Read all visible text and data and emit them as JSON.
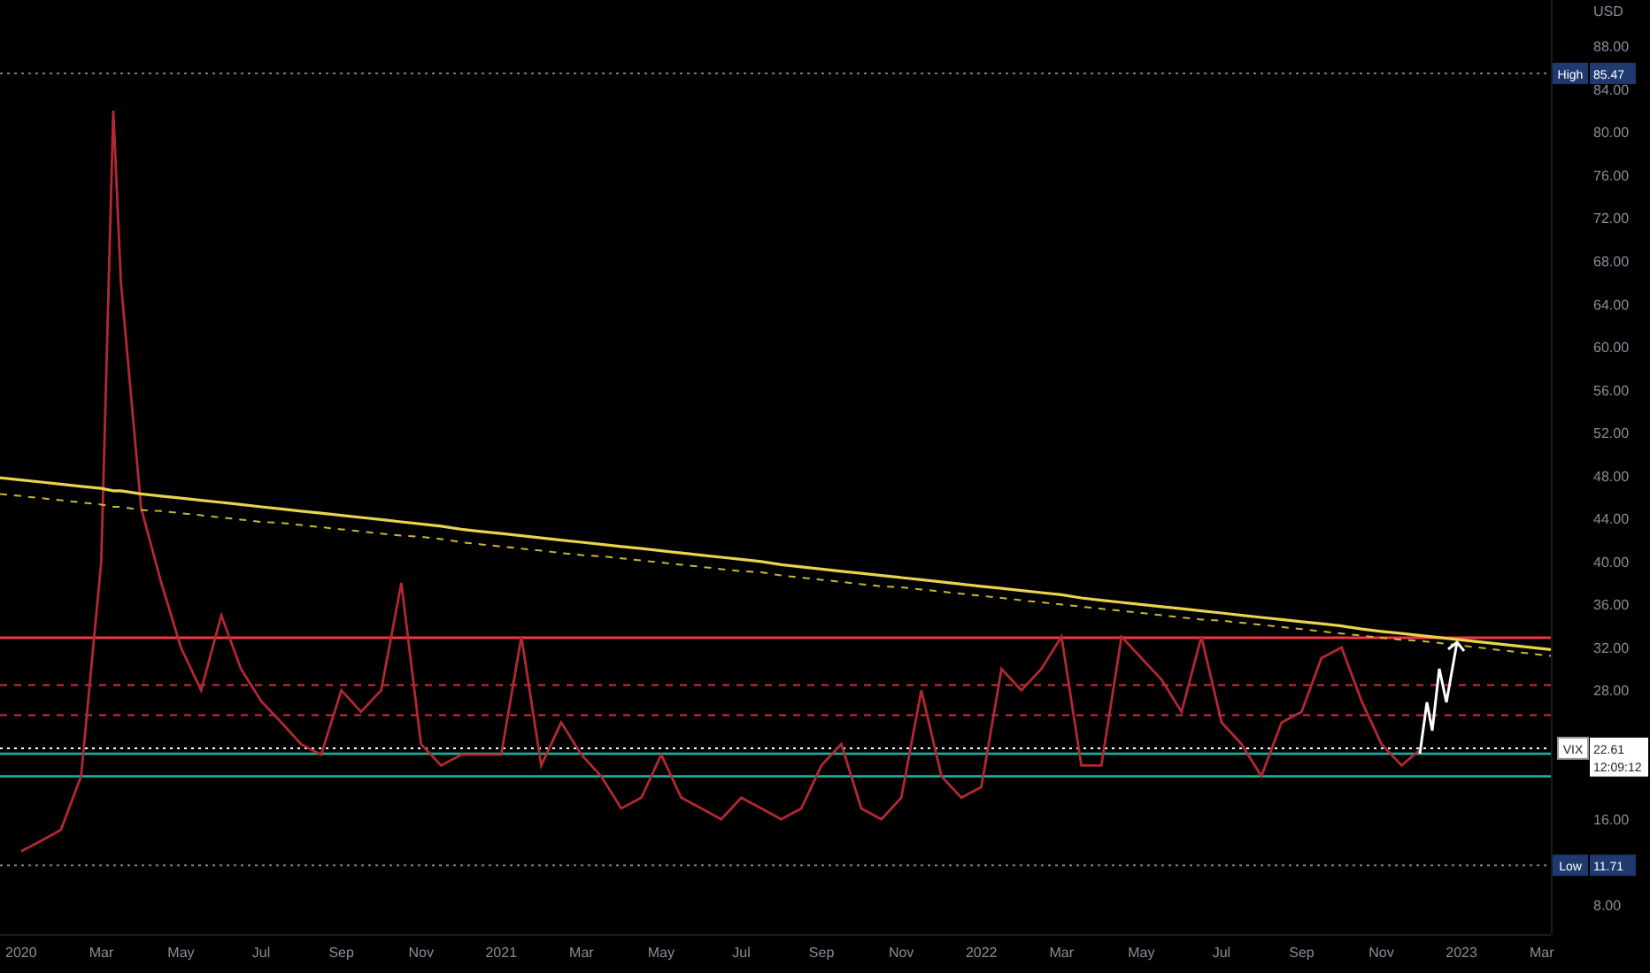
{
  "chart_data": {
    "type": "line",
    "ylabel": "USD",
    "xlim": [
      2019.956,
      2023.186
    ],
    "ylim": [
      5.3,
      92.3
    ],
    "xticks": [
      {
        "value": 2020,
        "label": "2020"
      },
      {
        "value": 2020.167,
        "label": "Mar"
      },
      {
        "value": 2020.333,
        "label": "May"
      },
      {
        "value": 2020.5,
        "label": "Jul"
      },
      {
        "value": 2020.667,
        "label": "Sep"
      },
      {
        "value": 2020.833,
        "label": "Nov"
      },
      {
        "value": 2021,
        "label": "2021"
      },
      {
        "value": 2021.167,
        "label": "Mar"
      },
      {
        "value": 2021.333,
        "label": "May"
      },
      {
        "value": 2021.5,
        "label": "Jul"
      },
      {
        "value": 2021.667,
        "label": "Sep"
      },
      {
        "value": 2021.833,
        "label": "Nov"
      },
      {
        "value": 2022,
        "label": "2022"
      },
      {
        "value": 2022.167,
        "label": "Mar"
      },
      {
        "value": 2022.333,
        "label": "May"
      },
      {
        "value": 2022.5,
        "label": "Jul"
      },
      {
        "value": 2022.667,
        "label": "Sep"
      },
      {
        "value": 2022.833,
        "label": "Nov"
      },
      {
        "value": 2023,
        "label": "2023"
      },
      {
        "value": 2023.167,
        "label": "Mar"
      }
    ],
    "yticks": [
      {
        "value": 88,
        "label": "88.00"
      },
      {
        "value": 84,
        "label": "84.00"
      },
      {
        "value": 80,
        "label": "80.00"
      },
      {
        "value": 76,
        "label": "76.00"
      },
      {
        "value": 72,
        "label": "72.00"
      },
      {
        "value": 68,
        "label": "68.00"
      },
      {
        "value": 64,
        "label": "64.00"
      },
      {
        "value": 60,
        "label": "60.00"
      },
      {
        "value": 56,
        "label": "56.00"
      },
      {
        "value": 52,
        "label": "52.00"
      },
      {
        "value": 48,
        "label": "48.00"
      },
      {
        "value": 44,
        "label": "44.00"
      },
      {
        "value": 40,
        "label": "40.00"
      },
      {
        "value": 36,
        "label": "36.00"
      },
      {
        "value": 32,
        "label": "32.00"
      },
      {
        "value": 28,
        "label": "28.00"
      },
      {
        "value": 16,
        "label": "16.00"
      },
      {
        "value": 8,
        "label": "8.00"
      }
    ],
    "x": [
      2019.956,
      2020,
      2020.042,
      2020.083,
      2020.125,
      2020.167,
      2020.192,
      2020.208,
      2020.25,
      2020.292,
      2020.333,
      2020.375,
      2020.417,
      2020.458,
      2020.5,
      2020.542,
      2020.583,
      2020.625,
      2020.667,
      2020.708,
      2020.75,
      2020.792,
      2020.833,
      2020.875,
      2020.917,
      2020.958,
      2021,
      2021.042,
      2021.083,
      2021.125,
      2021.167,
      2021.208,
      2021.25,
      2021.292,
      2021.333,
      2021.375,
      2021.417,
      2021.458,
      2021.5,
      2021.542,
      2021.583,
      2021.625,
      2021.667,
      2021.708,
      2021.75,
      2021.792,
      2021.833,
      2021.875,
      2021.917,
      2021.958,
      2022,
      2022.042,
      2022.083,
      2022.125,
      2022.167,
      2022.208,
      2022.25,
      2022.292,
      2022.333,
      2022.375,
      2022.417,
      2022.458,
      2022.5,
      2022.542,
      2022.583,
      2022.625,
      2022.667,
      2022.708,
      2022.75,
      2022.792,
      2022.833,
      2022.875,
      2022.917,
      2023.186
    ],
    "series": [
      {
        "name": "VIX",
        "color": "#b22833",
        "values": [
          null,
          13,
          14,
          15,
          20,
          40,
          82,
          66,
          45,
          38,
          32,
          28,
          35,
          30,
          27,
          25,
          23,
          22,
          28,
          26,
          28,
          38,
          23,
          21,
          22,
          22,
          22,
          33,
          21,
          25,
          22,
          20,
          17,
          18,
          22,
          18,
          17,
          16,
          18,
          17,
          16,
          17,
          21,
          23,
          17,
          16,
          18,
          28,
          20,
          18,
          19,
          30,
          28,
          30,
          33,
          21,
          21,
          33,
          31,
          29,
          26,
          33,
          25,
          23,
          20,
          25,
          26,
          31,
          32,
          27,
          23,
          21,
          22.6,
          null
        ]
      },
      {
        "color": "#e8d44d",
        "values": [
          47.8,
          47.6,
          47.4,
          47.2,
          47.0,
          46.8,
          46.6,
          46.6,
          46.3,
          46.1,
          45.9,
          45.7,
          45.5,
          45.3,
          45.1,
          44.9,
          44.7,
          44.5,
          44.3,
          44.1,
          43.9,
          43.7,
          43.5,
          43.3,
          43.0,
          42.8,
          42.6,
          42.4,
          42.2,
          42.0,
          41.8,
          41.6,
          41.4,
          41.2,
          41.0,
          40.8,
          40.6,
          40.4,
          40.2,
          40.0,
          39.7,
          39.5,
          39.3,
          39.1,
          38.9,
          38.7,
          38.5,
          38.3,
          38.1,
          37.9,
          37.7,
          37.5,
          37.3,
          37.1,
          36.9,
          36.6,
          36.4,
          36.2,
          36.0,
          35.8,
          35.6,
          35.4,
          35.2,
          35.0,
          34.8,
          34.6,
          34.4,
          34.2,
          34.0,
          33.7,
          33.5,
          33.3,
          33.1,
          31.8
        ]
      },
      {
        "color": "#c9b53a",
        "line_style": "dashed",
        "values": [
          46.3,
          46.1,
          45.9,
          45.7,
          45.5,
          45.3,
          45.1,
          45.1,
          44.8,
          44.7,
          44.5,
          44.3,
          44.1,
          43.9,
          43.7,
          43.6,
          43.4,
          43.2,
          43.0,
          42.8,
          42.6,
          42.4,
          42.3,
          42.1,
          41.8,
          41.6,
          41.4,
          41.2,
          41.0,
          40.8,
          40.6,
          40.5,
          40.3,
          40.1,
          39.9,
          39.7,
          39.5,
          39.3,
          39.1,
          39.0,
          38.7,
          38.5,
          38.3,
          38.1,
          37.9,
          37.7,
          37.6,
          37.4,
          37.2,
          37.0,
          36.8,
          36.6,
          36.4,
          36.2,
          36.0,
          35.8,
          35.6,
          35.4,
          35.2,
          35.0,
          34.8,
          34.6,
          34.5,
          34.3,
          34.1,
          33.9,
          33.7,
          33.5,
          33.3,
          33.1,
          32.9,
          32.7,
          32.6,
          31.2
        ]
      }
    ],
    "ref_lines": [
      {
        "axis": "y",
        "value": 85.47,
        "color": "#787b86",
        "line_style": "dotted"
      },
      {
        "axis": "y",
        "value": 32.9,
        "color": "#f23645",
        "line_style": "solid"
      },
      {
        "axis": "y",
        "value": 28.5,
        "color": "#d0303c",
        "line_style": "dashed"
      },
      {
        "axis": "y",
        "value": 25.7,
        "color": "#d0303c",
        "line_style": "dashed"
      },
      {
        "axis": "y",
        "value": 22.61,
        "color": "#ffffff",
        "line_style": "dotted"
      },
      {
        "axis": "y",
        "value": 22.1,
        "color": "#22ab94",
        "line_style": "solid"
      },
      {
        "axis": "y",
        "value": 20.0,
        "color": "#22ab94",
        "line_style": "solid"
      },
      {
        "axis": "y",
        "value": 11.71,
        "color": "#787b86",
        "line_style": "dotted"
      }
    ]
  },
  "price_labels": [
    {
      "kind": "high",
      "label": "High",
      "value": "85.47"
    },
    {
      "kind": "last",
      "value": "22.61",
      "time": "12:09:12"
    },
    {
      "kind": "low",
      "label": "Low",
      "value": "11.71"
    }
  ]
}
